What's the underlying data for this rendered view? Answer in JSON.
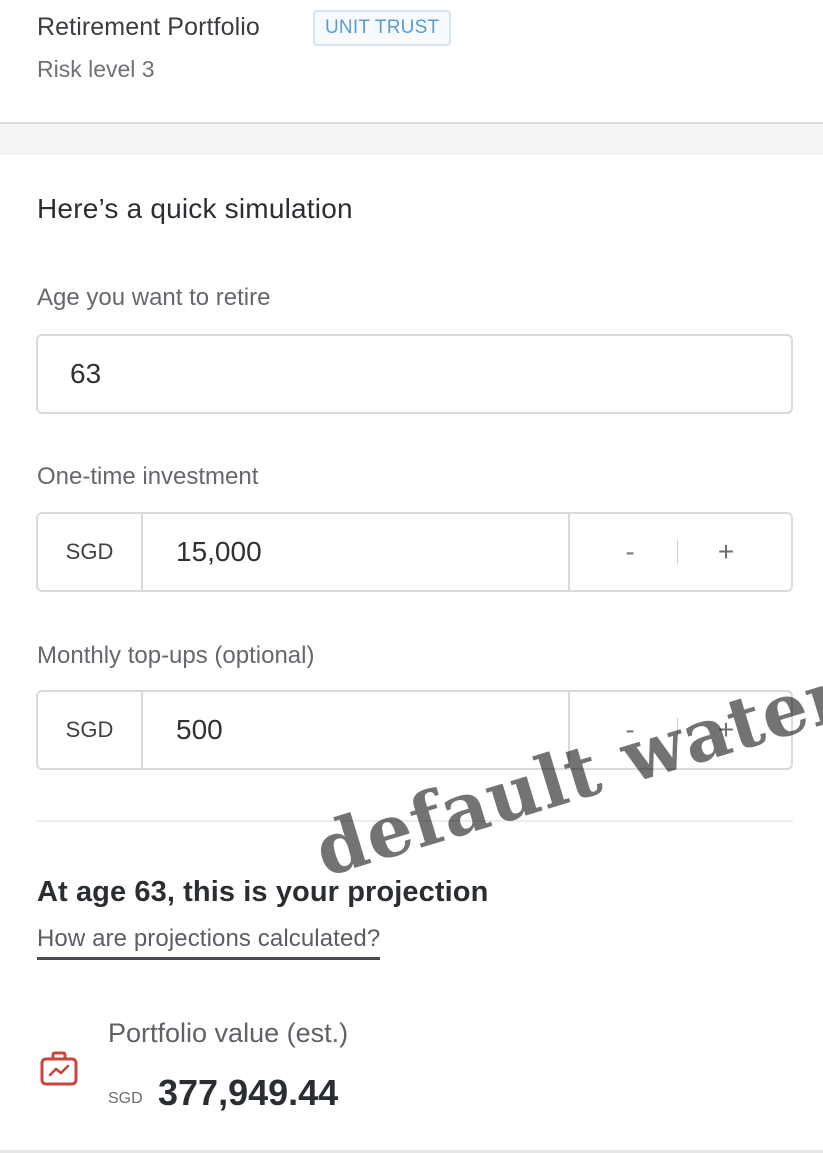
{
  "header": {
    "fund_name": "Retirement Portfolio",
    "fund_badge": "UNIT TRUST",
    "risk_level": "Risk level 3"
  },
  "simulation": {
    "title": "Here’s a quick simulation",
    "retire_age": {
      "label": "Age you want to retire",
      "value": "63"
    },
    "one_time": {
      "label": "One-time investment",
      "currency": "SGD",
      "value": "15,000",
      "minus": "-",
      "plus": "+"
    },
    "monthly": {
      "label": "Monthly top-ups (optional)",
      "currency": "SGD",
      "value": "500",
      "minus": "-",
      "plus": "+"
    }
  },
  "projection": {
    "title": "At age 63, this is your projection",
    "link": "How are projections calculated?",
    "portfolio_label": "Portfolio value (est.)",
    "currency": "SGD",
    "value": "377,949.44",
    "icon": "briefcase-chart-icon",
    "icon_color": "#c8453c"
  },
  "watermark": "default waterma",
  "colors": {
    "badge_text": "#5b9bd0",
    "badge_border": "#d6e6f1"
  }
}
